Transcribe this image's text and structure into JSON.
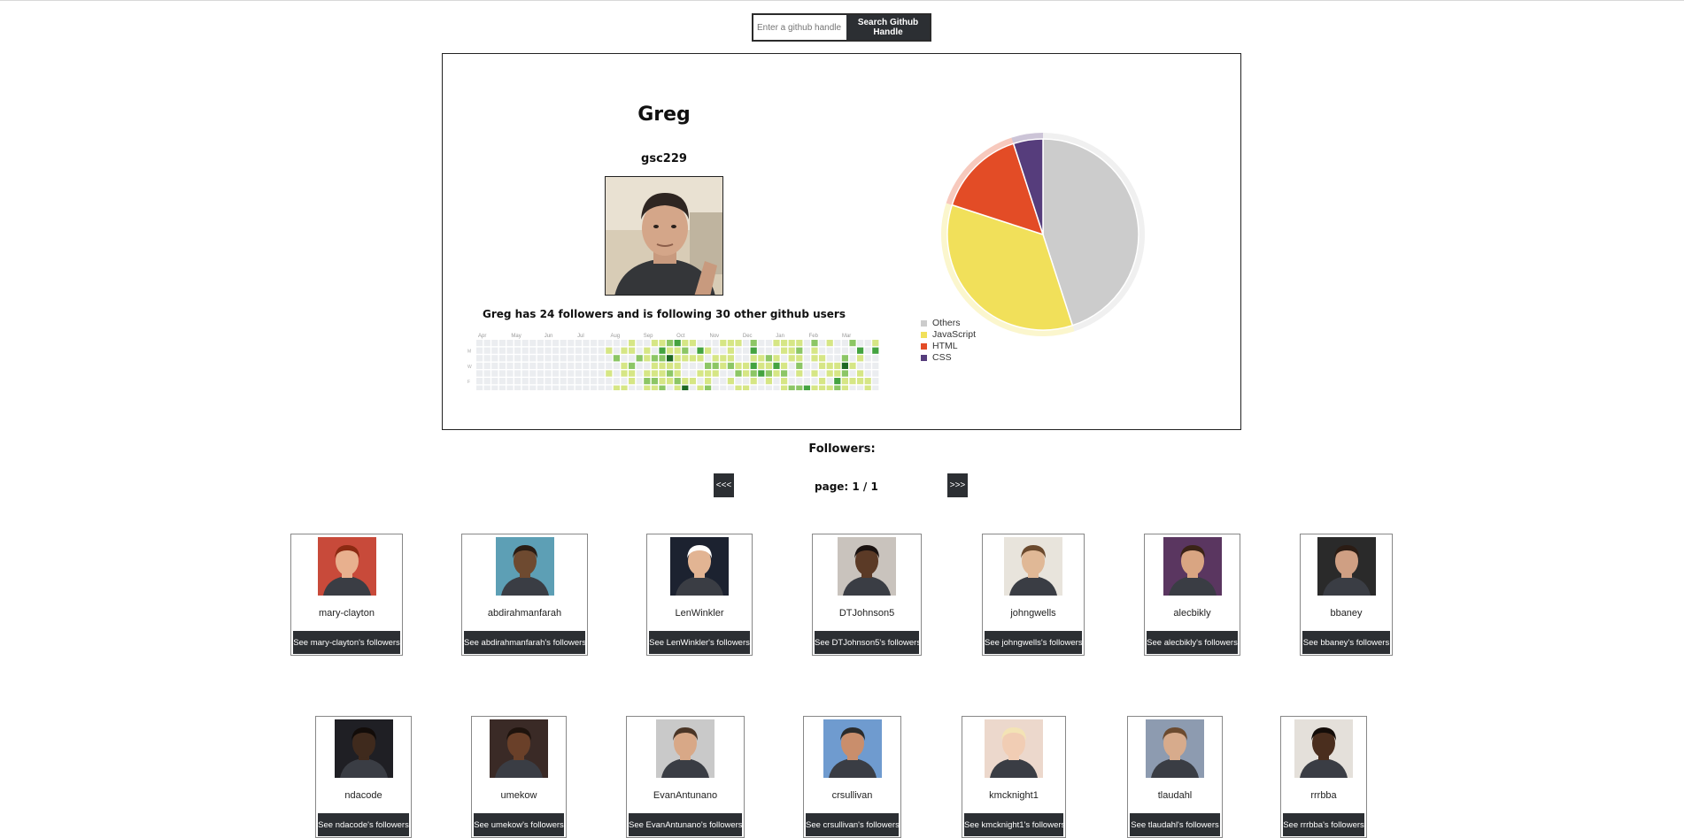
{
  "search": {
    "placeholder": "Enter a github handle here",
    "button_label": "Search Github Handle"
  },
  "profile": {
    "name": "Greg",
    "login": "gsc229",
    "avatar_icon": "person-photo",
    "summary": "Greg has 24 followers and is following 30 other github users"
  },
  "calendar": {
    "months": [
      "Apr",
      "May",
      "Jun",
      "Jul",
      "Aug",
      "Sep",
      "Oct",
      "Nov",
      "Dec",
      "Jan",
      "Feb",
      "Mar"
    ],
    "day_labels": [
      "M",
      "W",
      "F"
    ],
    "colors": [
      "#ebedf0",
      "#d6e685",
      "#8cc665",
      "#44a340",
      "#1e6823"
    ]
  },
  "chart_data": {
    "type": "pie",
    "title": "",
    "slices": [
      {
        "label": "Others",
        "value": 45,
        "color": "#cccccc"
      },
      {
        "label": "JavaScript",
        "value": 35,
        "color": "#f1e05a"
      },
      {
        "label": "HTML",
        "value": 15,
        "color": "#e34c26"
      },
      {
        "label": "CSS",
        "value": 5,
        "color": "#563d7c"
      }
    ],
    "legend_position": "bottom-left"
  },
  "followers_section": {
    "title": "Followers:",
    "prev_label": "<<<",
    "next_label": ">>>",
    "page_text": "page: 1 / 1"
  },
  "followers": [
    {
      "login": "mary-clayton",
      "button": "See mary-clayton's followers",
      "skin": "#e8b08e",
      "hair": "#8b2a12",
      "bg": "#c84a3a"
    },
    {
      "login": "abdirahmanfarah",
      "button": "See abdirahmanfarah's followers",
      "skin": "#6e4a30",
      "hair": "#2a1d14",
      "bg": "#5d9fb5"
    },
    {
      "login": "LenWinkler",
      "button": "See LenWinkler's followers",
      "skin": "#e2b493",
      "hair": "#ffffff",
      "bg": "#1c2230"
    },
    {
      "login": "DTJohnson5",
      "button": "See DTJohnson5's followers",
      "skin": "#5b3a26",
      "hair": "#1a1210",
      "bg": "#c9c3bd"
    },
    {
      "login": "johngwells",
      "button": "See johngwells's followers",
      "skin": "#e0b896",
      "hair": "#6b4a2e",
      "bg": "#e8e4dc"
    },
    {
      "login": "alecbikly",
      "button": "See alecbikly's followers",
      "skin": "#d9a582",
      "hair": "#3b2417",
      "bg": "#5a3660"
    },
    {
      "login": "bbaney",
      "button": "See bbaney's followers",
      "skin": "#cf9f83",
      "hair": "#2b1c14",
      "bg": "#2a2a2a"
    },
    {
      "login": "ndacode",
      "button": "See ndacode's followers",
      "skin": "#3f2a1d",
      "hair": "#120c09",
      "bg": "#1f1f24"
    },
    {
      "login": "umekow",
      "button": "See umekow's followers",
      "skin": "#6a4029",
      "hair": "#1e130d",
      "bg": "#3a2a26"
    },
    {
      "login": "EvanAntunano",
      "button": "See EvanAntunano's followers",
      "skin": "#d8a887",
      "hair": "#4a3526",
      "bg": "#c9c9c9"
    },
    {
      "login": "crsullivan",
      "button": "See crsullivan's followers",
      "skin": "#c98e6c",
      "hair": "#2b2b2b",
      "bg": "#6f9bcf"
    },
    {
      "login": "kmcknight1",
      "button": "See kmcknight1's followers",
      "skin": "#f1cdb4",
      "hair": "#f3e3b5",
      "bg": "#ecd8cc"
    },
    {
      "login": "tlaudahl",
      "button": "See tlaudahl's followers",
      "skin": "#d7ab8c",
      "hair": "#6b4a2f",
      "bg": "#8d9bb0"
    },
    {
      "login": "rrrbba",
      "button": "See rrrbba's followers",
      "skin": "#4a2e1e",
      "hair": "#140d09",
      "bg": "#e4e0da"
    }
  ]
}
